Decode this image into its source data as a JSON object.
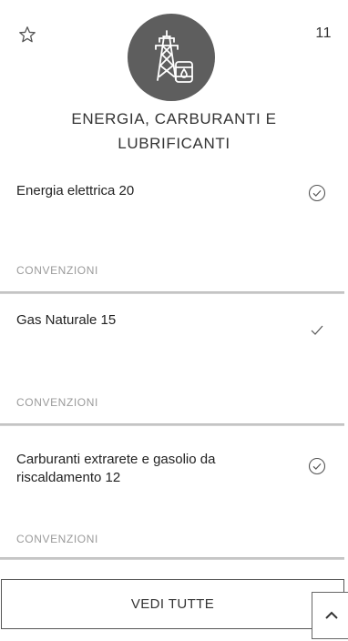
{
  "header": {
    "favorite_icon": "star-outline-icon",
    "count": "11",
    "category_icon": "power-pylon-fuel-barrel-icon",
    "category_title": "ENERGIA, CARBURANTI E LUBRIFICANTI"
  },
  "items": [
    {
      "title": "Energia elettrica 20",
      "status_icon": "circle-check-icon",
      "tag": "CONVENZIONI"
    },
    {
      "title": "Gas Naturale 15",
      "status_icon": "check-icon",
      "tag": "CONVENZIONI"
    },
    {
      "title": "Carburanti extrarete e gasolio da riscaldamento 12",
      "status_icon": "circle-check-icon",
      "tag": "CONVENZIONI"
    }
  ],
  "footer": {
    "see_all_label": "VEDI TUTTE",
    "back_to_top_icon": "chevron-up-icon"
  },
  "colors": {
    "icon_circle": "#5e5e5e",
    "tag_text": "#9a9a9a",
    "divider": "#c4c4c4"
  }
}
